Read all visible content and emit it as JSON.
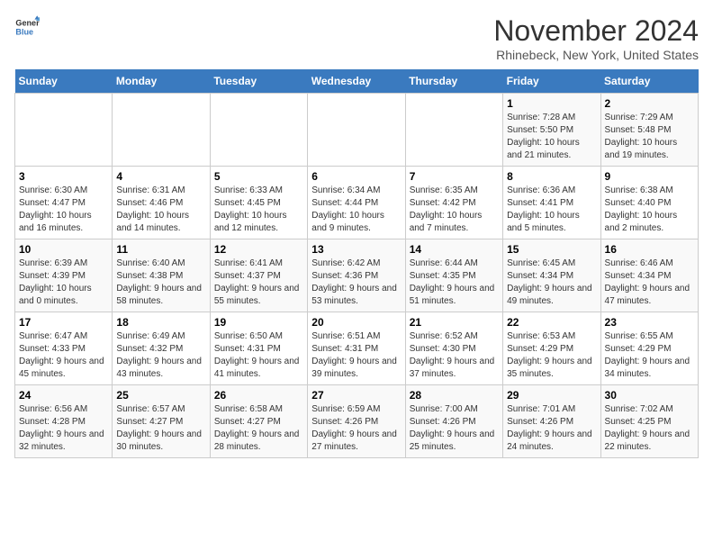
{
  "logo": {
    "line1": "General",
    "line2": "Blue"
  },
  "title": "November 2024",
  "subtitle": "Rhinebeck, New York, United States",
  "days_of_week": [
    "Sunday",
    "Monday",
    "Tuesday",
    "Wednesday",
    "Thursday",
    "Friday",
    "Saturday"
  ],
  "weeks": [
    [
      {
        "day": "",
        "info": ""
      },
      {
        "day": "",
        "info": ""
      },
      {
        "day": "",
        "info": ""
      },
      {
        "day": "",
        "info": ""
      },
      {
        "day": "",
        "info": ""
      },
      {
        "day": "1",
        "info": "Sunrise: 7:28 AM\nSunset: 5:50 PM\nDaylight: 10 hours and 21 minutes."
      },
      {
        "day": "2",
        "info": "Sunrise: 7:29 AM\nSunset: 5:48 PM\nDaylight: 10 hours and 19 minutes."
      }
    ],
    [
      {
        "day": "3",
        "info": "Sunrise: 6:30 AM\nSunset: 4:47 PM\nDaylight: 10 hours and 16 minutes."
      },
      {
        "day": "4",
        "info": "Sunrise: 6:31 AM\nSunset: 4:46 PM\nDaylight: 10 hours and 14 minutes."
      },
      {
        "day": "5",
        "info": "Sunrise: 6:33 AM\nSunset: 4:45 PM\nDaylight: 10 hours and 12 minutes."
      },
      {
        "day": "6",
        "info": "Sunrise: 6:34 AM\nSunset: 4:44 PM\nDaylight: 10 hours and 9 minutes."
      },
      {
        "day": "7",
        "info": "Sunrise: 6:35 AM\nSunset: 4:42 PM\nDaylight: 10 hours and 7 minutes."
      },
      {
        "day": "8",
        "info": "Sunrise: 6:36 AM\nSunset: 4:41 PM\nDaylight: 10 hours and 5 minutes."
      },
      {
        "day": "9",
        "info": "Sunrise: 6:38 AM\nSunset: 4:40 PM\nDaylight: 10 hours and 2 minutes."
      }
    ],
    [
      {
        "day": "10",
        "info": "Sunrise: 6:39 AM\nSunset: 4:39 PM\nDaylight: 10 hours and 0 minutes."
      },
      {
        "day": "11",
        "info": "Sunrise: 6:40 AM\nSunset: 4:38 PM\nDaylight: 9 hours and 58 minutes."
      },
      {
        "day": "12",
        "info": "Sunrise: 6:41 AM\nSunset: 4:37 PM\nDaylight: 9 hours and 55 minutes."
      },
      {
        "day": "13",
        "info": "Sunrise: 6:42 AM\nSunset: 4:36 PM\nDaylight: 9 hours and 53 minutes."
      },
      {
        "day": "14",
        "info": "Sunrise: 6:44 AM\nSunset: 4:35 PM\nDaylight: 9 hours and 51 minutes."
      },
      {
        "day": "15",
        "info": "Sunrise: 6:45 AM\nSunset: 4:34 PM\nDaylight: 9 hours and 49 minutes."
      },
      {
        "day": "16",
        "info": "Sunrise: 6:46 AM\nSunset: 4:34 PM\nDaylight: 9 hours and 47 minutes."
      }
    ],
    [
      {
        "day": "17",
        "info": "Sunrise: 6:47 AM\nSunset: 4:33 PM\nDaylight: 9 hours and 45 minutes."
      },
      {
        "day": "18",
        "info": "Sunrise: 6:49 AM\nSunset: 4:32 PM\nDaylight: 9 hours and 43 minutes."
      },
      {
        "day": "19",
        "info": "Sunrise: 6:50 AM\nSunset: 4:31 PM\nDaylight: 9 hours and 41 minutes."
      },
      {
        "day": "20",
        "info": "Sunrise: 6:51 AM\nSunset: 4:31 PM\nDaylight: 9 hours and 39 minutes."
      },
      {
        "day": "21",
        "info": "Sunrise: 6:52 AM\nSunset: 4:30 PM\nDaylight: 9 hours and 37 minutes."
      },
      {
        "day": "22",
        "info": "Sunrise: 6:53 AM\nSunset: 4:29 PM\nDaylight: 9 hours and 35 minutes."
      },
      {
        "day": "23",
        "info": "Sunrise: 6:55 AM\nSunset: 4:29 PM\nDaylight: 9 hours and 34 minutes."
      }
    ],
    [
      {
        "day": "24",
        "info": "Sunrise: 6:56 AM\nSunset: 4:28 PM\nDaylight: 9 hours and 32 minutes."
      },
      {
        "day": "25",
        "info": "Sunrise: 6:57 AM\nSunset: 4:27 PM\nDaylight: 9 hours and 30 minutes."
      },
      {
        "day": "26",
        "info": "Sunrise: 6:58 AM\nSunset: 4:27 PM\nDaylight: 9 hours and 28 minutes."
      },
      {
        "day": "27",
        "info": "Sunrise: 6:59 AM\nSunset: 4:26 PM\nDaylight: 9 hours and 27 minutes."
      },
      {
        "day": "28",
        "info": "Sunrise: 7:00 AM\nSunset: 4:26 PM\nDaylight: 9 hours and 25 minutes."
      },
      {
        "day": "29",
        "info": "Sunrise: 7:01 AM\nSunset: 4:26 PM\nDaylight: 9 hours and 24 minutes."
      },
      {
        "day": "30",
        "info": "Sunrise: 7:02 AM\nSunset: 4:25 PM\nDaylight: 9 hours and 22 minutes."
      }
    ]
  ],
  "accent_color": "#3a7abf"
}
